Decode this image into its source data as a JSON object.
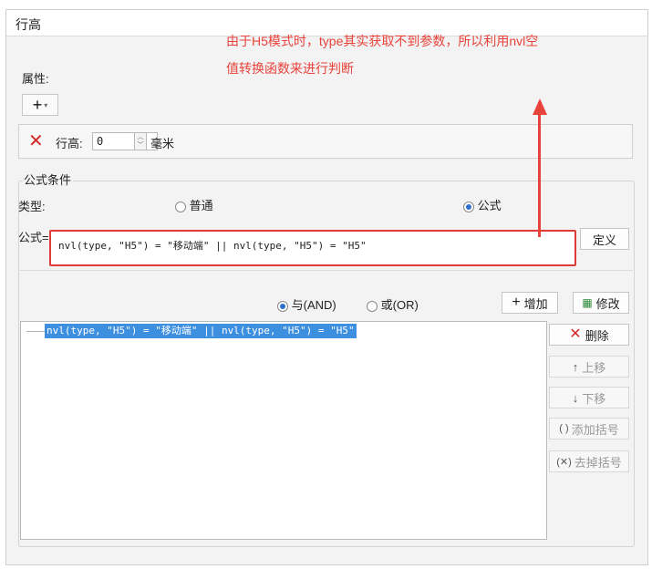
{
  "dialog": {
    "title": "行高"
  },
  "annotation": {
    "line1": "由于H5模式时，type其实获取不到参数，所以利用nvl空",
    "line2": "值转换函数来进行判断"
  },
  "properties": {
    "label": "属性:",
    "add_symbol": "+",
    "caret": "▾",
    "row_height_label": "行高:",
    "row_height_value": "0",
    "unit": "毫米"
  },
  "formula_condition": {
    "title": "公式条件",
    "type_label": "类型:",
    "type_options": [
      {
        "label": "普通",
        "selected": false
      },
      {
        "label": "公式",
        "selected": true
      }
    ],
    "formula_label": "公式=",
    "formula_value": "nvl(type, \"H5\") = \"移动端\" || nvl(type, \"H5\") = \"H5\"",
    "define_button": "定义",
    "logic_options": [
      {
        "label": "与(AND)",
        "selected": true
      },
      {
        "label": "或(OR)",
        "selected": false
      }
    ],
    "add_button": "增加",
    "modify_button": "修改",
    "conditions": [
      "nvl(type, \"H5\") = \"移动端\" || nvl(type, \"H5\") = \"H5\""
    ],
    "side_buttons": {
      "delete": "删除",
      "move_up": "上移",
      "move_down": "下移",
      "add_bracket": "添加括号",
      "remove_bracket": "去掉括号"
    }
  },
  "colors": {
    "annotation": "#e8433b",
    "selection": "#3d8fe0",
    "delete_icon": "#d42a2a"
  }
}
